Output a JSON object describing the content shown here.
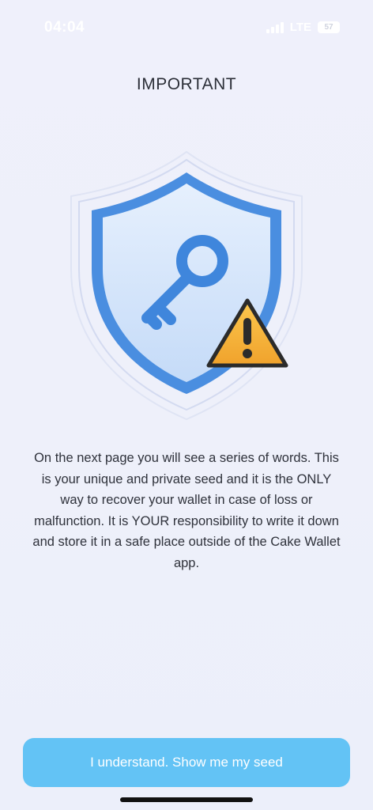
{
  "status_bar": {
    "time": "04:04",
    "network": "LTE",
    "battery_level": "57"
  },
  "header": {
    "title": "IMPORTANT"
  },
  "hero": {
    "icons": [
      "shield-icon",
      "key-icon",
      "warning-icon"
    ],
    "colors": {
      "shield_fill": "#cfe3fb",
      "shield_border": "#4a8ee0",
      "key": "#3f86dc",
      "warning_fill": "#f5b43a",
      "warning_outline": "#2b2b2b"
    }
  },
  "body": {
    "description": "On the next page you will see a series of words. This is your unique and private seed and it is the ONLY way to recover your wallet in case of loss or malfunction. It is YOUR responsibility to write it down and store it in a safe place outside of the Cake Wallet app."
  },
  "actions": {
    "confirm_label": "I understand. Show me my seed",
    "confirm_color": "#63c3f5"
  }
}
